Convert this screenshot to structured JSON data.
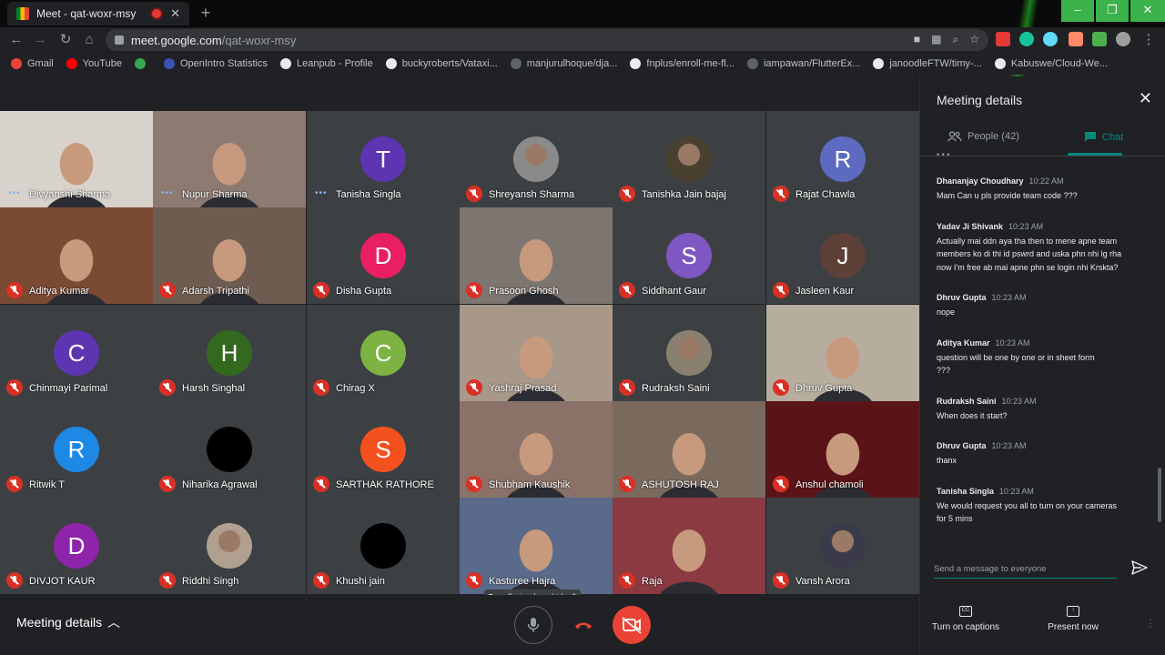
{
  "browser": {
    "tab_title": "Meet - qat-woxr-msy",
    "url_host": "meet.google.com",
    "url_path": "/qat-woxr-msy",
    "bookmarks": [
      {
        "label": "Gmail",
        "color": "#ea4335"
      },
      {
        "label": "YouTube",
        "color": "#ff0000"
      },
      {
        "label": "",
        "color": "#34a853"
      },
      {
        "label": "OpenIntro Statistics",
        "color": "#3f51b5"
      },
      {
        "label": "Leanpub - Profile",
        "color": "#e8eaed"
      },
      {
        "label": "buckyroberts/Vataxi...",
        "color": "#e8eaed"
      },
      {
        "label": "manjurulhoque/dja...",
        "color": "#5f6368"
      },
      {
        "label": "fnplus/enroll-me-fl...",
        "color": "#e8eaed"
      },
      {
        "label": "iampawan/FlutterEx...",
        "color": "#5f6368"
      },
      {
        "label": "janoodleFTW/timy-...",
        "color": "#e8eaed"
      },
      {
        "label": "Kabuswe/Cloud-We...",
        "color": "#e8eaed"
      }
    ]
  },
  "participants": [
    {
      "name": "Divyanshi Sharma",
      "type": "video",
      "bg": "#d8d2cc",
      "state": "speaking",
      "highlight": true
    },
    {
      "name": "Nupur Sharma",
      "type": "video",
      "bg": "#8d7b72",
      "state": "speaking"
    },
    {
      "name": "Tanisha Singla",
      "type": "avatar",
      "letter": "T",
      "color": "#5e35b1",
      "state": "speaking"
    },
    {
      "name": "Shreyansh Sharma",
      "type": "photo",
      "color": "#8a8a8a",
      "state": "muted"
    },
    {
      "name": "Tanishka Jain bajaj",
      "type": "photo",
      "color": "#4a4030",
      "state": "muted"
    },
    {
      "name": "Rajat Chawla",
      "type": "avatar",
      "letter": "R",
      "color": "#5c6bc0",
      "state": "muted"
    },
    {
      "name": "Aditya Kumar",
      "type": "video",
      "bg": "#7a4a32",
      "state": "muted"
    },
    {
      "name": "Adarsh Tripathi",
      "type": "video",
      "bg": "#6e5c50",
      "state": "muted"
    },
    {
      "name": "Disha Gupta",
      "type": "avatar",
      "letter": "D",
      "color": "#e91e63",
      "state": "muted"
    },
    {
      "name": "Prasoon Ghosh",
      "type": "video",
      "bg": "#7d7670",
      "state": "muted"
    },
    {
      "name": "Siddhant Gaur",
      "type": "avatar",
      "letter": "S",
      "color": "#7e57c2",
      "state": "muted"
    },
    {
      "name": "Jasleen Kaur",
      "type": "avatar",
      "letter": "J",
      "color": "#5d4037",
      "state": "muted"
    },
    {
      "name": "Chinmayi Parimal",
      "type": "avatar",
      "letter": "C",
      "color": "#5e35b1",
      "state": "muted"
    },
    {
      "name": "Harsh Singhal",
      "type": "avatar",
      "letter": "H",
      "color": "#33691e",
      "state": "muted"
    },
    {
      "name": "Chirag X",
      "type": "avatar",
      "letter": "C",
      "color": "#7cb342",
      "state": "muted"
    },
    {
      "name": "Yashraj Prasad",
      "type": "video",
      "bg": "#a8988a",
      "state": "muted"
    },
    {
      "name": "Rudraksh Saini",
      "type": "photo",
      "color": "#8a8070",
      "state": "muted"
    },
    {
      "name": "Dhruv Gupta",
      "type": "video",
      "bg": "#b7ad9f",
      "state": "muted"
    },
    {
      "name": "Ritwik T",
      "type": "avatar",
      "letter": "R",
      "color": "#1e88e5",
      "state": "muted"
    },
    {
      "name": "Niharika Agrawal",
      "type": "photo",
      "color": "#000000",
      "state": "muted"
    },
    {
      "name": "SARTHAK RATHORE",
      "type": "avatar",
      "letter": "S",
      "color": "#f4511e",
      "state": "muted"
    },
    {
      "name": "Shubham Kaushik",
      "type": "video",
      "bg": "#8a7268",
      "state": "muted"
    },
    {
      "name": "ASHUTOSH RAJ",
      "type": "video",
      "bg": "#7a6a5e",
      "state": "muted"
    },
    {
      "name": "Anshul chamoli",
      "type": "video",
      "bg": "#5a1418",
      "state": "muted"
    },
    {
      "name": "DIVJOT KAUR",
      "type": "avatar",
      "letter": "D",
      "color": "#8e24aa",
      "state": "muted"
    },
    {
      "name": "Riddhi Singh",
      "type": "photo",
      "color": "#b0a090",
      "state": "muted"
    },
    {
      "name": "Khushi jain",
      "type": "photo",
      "color": "#000000",
      "state": "muted"
    },
    {
      "name": "Kasturee Hajra",
      "type": "video",
      "bg": "#5a6a8a",
      "state": "muted"
    },
    {
      "name": "Raja",
      "type": "video",
      "bg": "#8a3a40",
      "state": "muted"
    },
    {
      "name": "Vansh Arora",
      "type": "photo",
      "color": "#3a3a4a",
      "state": "muted"
    }
  ],
  "tooltip": "Turn off microphone (ctrl + d)",
  "bottom": {
    "meeting_details": "Meeting details",
    "captions": "Turn on captions",
    "present": "Present now"
  },
  "panel": {
    "title": "Meeting details",
    "people_tab": "People (42)",
    "chat_tab": "Chat",
    "compose_placeholder": "Send a message to everyone",
    "messages": [
      {
        "name": "Dhananjay Choudhary",
        "time": "10:22 AM",
        "lines": [
          "Mam Can u pls provide team code ???"
        ]
      },
      {
        "name": "Yadav Ji Shivank",
        "time": "10:23 AM",
        "lines": [
          "Actually mai ddn aya tha then to mene apne team",
          "members ko di thi id pswrd and uska phn nhi lg rha",
          "now I'm free ab mai apne phn se login nhi Krskta?"
        ]
      },
      {
        "name": "Dhruv Gupta",
        "time": "10:23 AM",
        "lines": [
          "nope"
        ]
      },
      {
        "name": "Aditya Kumar",
        "time": "10:23 AM",
        "lines": [
          "question will be one by one or in sheet form",
          "???"
        ]
      },
      {
        "name": "Rudraksh Saini",
        "time": "10:23 AM",
        "lines": [
          "When does it start?"
        ]
      },
      {
        "name": "Dhruv Gupta",
        "time": "10:23 AM",
        "lines": [
          "thanx"
        ]
      },
      {
        "name": "Tanisha Singla",
        "time": "10:23 AM",
        "lines": [
          "We would request you all to turn on your cameras",
          "for 5 mins"
        ]
      }
    ]
  }
}
